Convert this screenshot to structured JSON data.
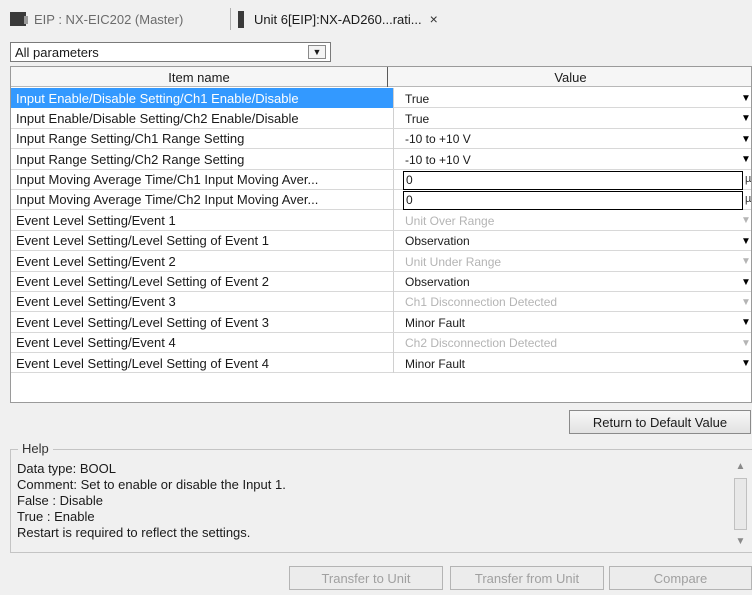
{
  "tabs": [
    {
      "label": "EIP : NX-EIC202 (Master)"
    },
    {
      "label": "Unit 6[EIP]:NX-AD260...rati...",
      "close": "×"
    }
  ],
  "filter": {
    "value": "All parameters",
    "arrow": "▼"
  },
  "grid": {
    "headers": {
      "item": "Item name",
      "value": "Value"
    },
    "rows": [
      {
        "name": "Input Enable/Disable Setting/Ch1 Enable/Disable",
        "value": "True",
        "arrow": "▼"
      },
      {
        "name": "Input Enable/Disable Setting/Ch2 Enable/Disable",
        "value": "True",
        "arrow": "▼"
      },
      {
        "name": "Input Range Setting/Ch1 Range Setting",
        "value": "-10 to +10 V",
        "arrow": "▼"
      },
      {
        "name": "Input Range Setting/Ch2 Range Setting",
        "value": "-10 to +10 V",
        "arrow": "▼"
      },
      {
        "name": "Input Moving Average Time/Ch1 Input Moving Aver...",
        "value": "0",
        "unit": "µ"
      },
      {
        "name": "Input Moving Average Time/Ch2 Input Moving Aver...",
        "value": "0",
        "unit": "µ"
      },
      {
        "name": "Event Level Setting/Event 1",
        "value": "Unit Over Range",
        "arrow": "▼"
      },
      {
        "name": "Event Level Setting/Level Setting of Event 1",
        "value": "Observation",
        "arrow": "▼"
      },
      {
        "name": "Event Level Setting/Event 2",
        "value": "Unit Under Range",
        "arrow": "▼"
      },
      {
        "name": "Event Level Setting/Level Setting of Event 2",
        "value": "Observation",
        "arrow": "▼"
      },
      {
        "name": "Event Level Setting/Event 3",
        "value": "Ch1 Disconnection Detected",
        "arrow": "▼"
      },
      {
        "name": "Event Level Setting/Level Setting of Event 3",
        "value": "Minor Fault",
        "arrow": "▼"
      },
      {
        "name": "Event Level Setting/Event 4",
        "value": "Ch2 Disconnection Detected",
        "arrow": "▼"
      },
      {
        "name": "Event Level Setting/Level Setting of Event 4",
        "value": "Minor Fault",
        "arrow": "▼"
      }
    ]
  },
  "buttons": {
    "return_default": "Return to Default Value",
    "transfer_to_unit": "Transfer to Unit",
    "transfer_from_unit": "Transfer from Unit",
    "compare": "Compare"
  },
  "help": {
    "title": "Help",
    "lines": [
      "Data type: BOOL",
      "Comment: Set to enable or disable the Input 1.",
      "False :  Disable",
      "True :  Enable",
      "Restart is required to reflect the settings."
    ],
    "scroll_up": "▲",
    "scroll_down": "▼"
  },
  "colors": {
    "selection": "#3399ff",
    "disabled_text": "#b4b4b4"
  }
}
